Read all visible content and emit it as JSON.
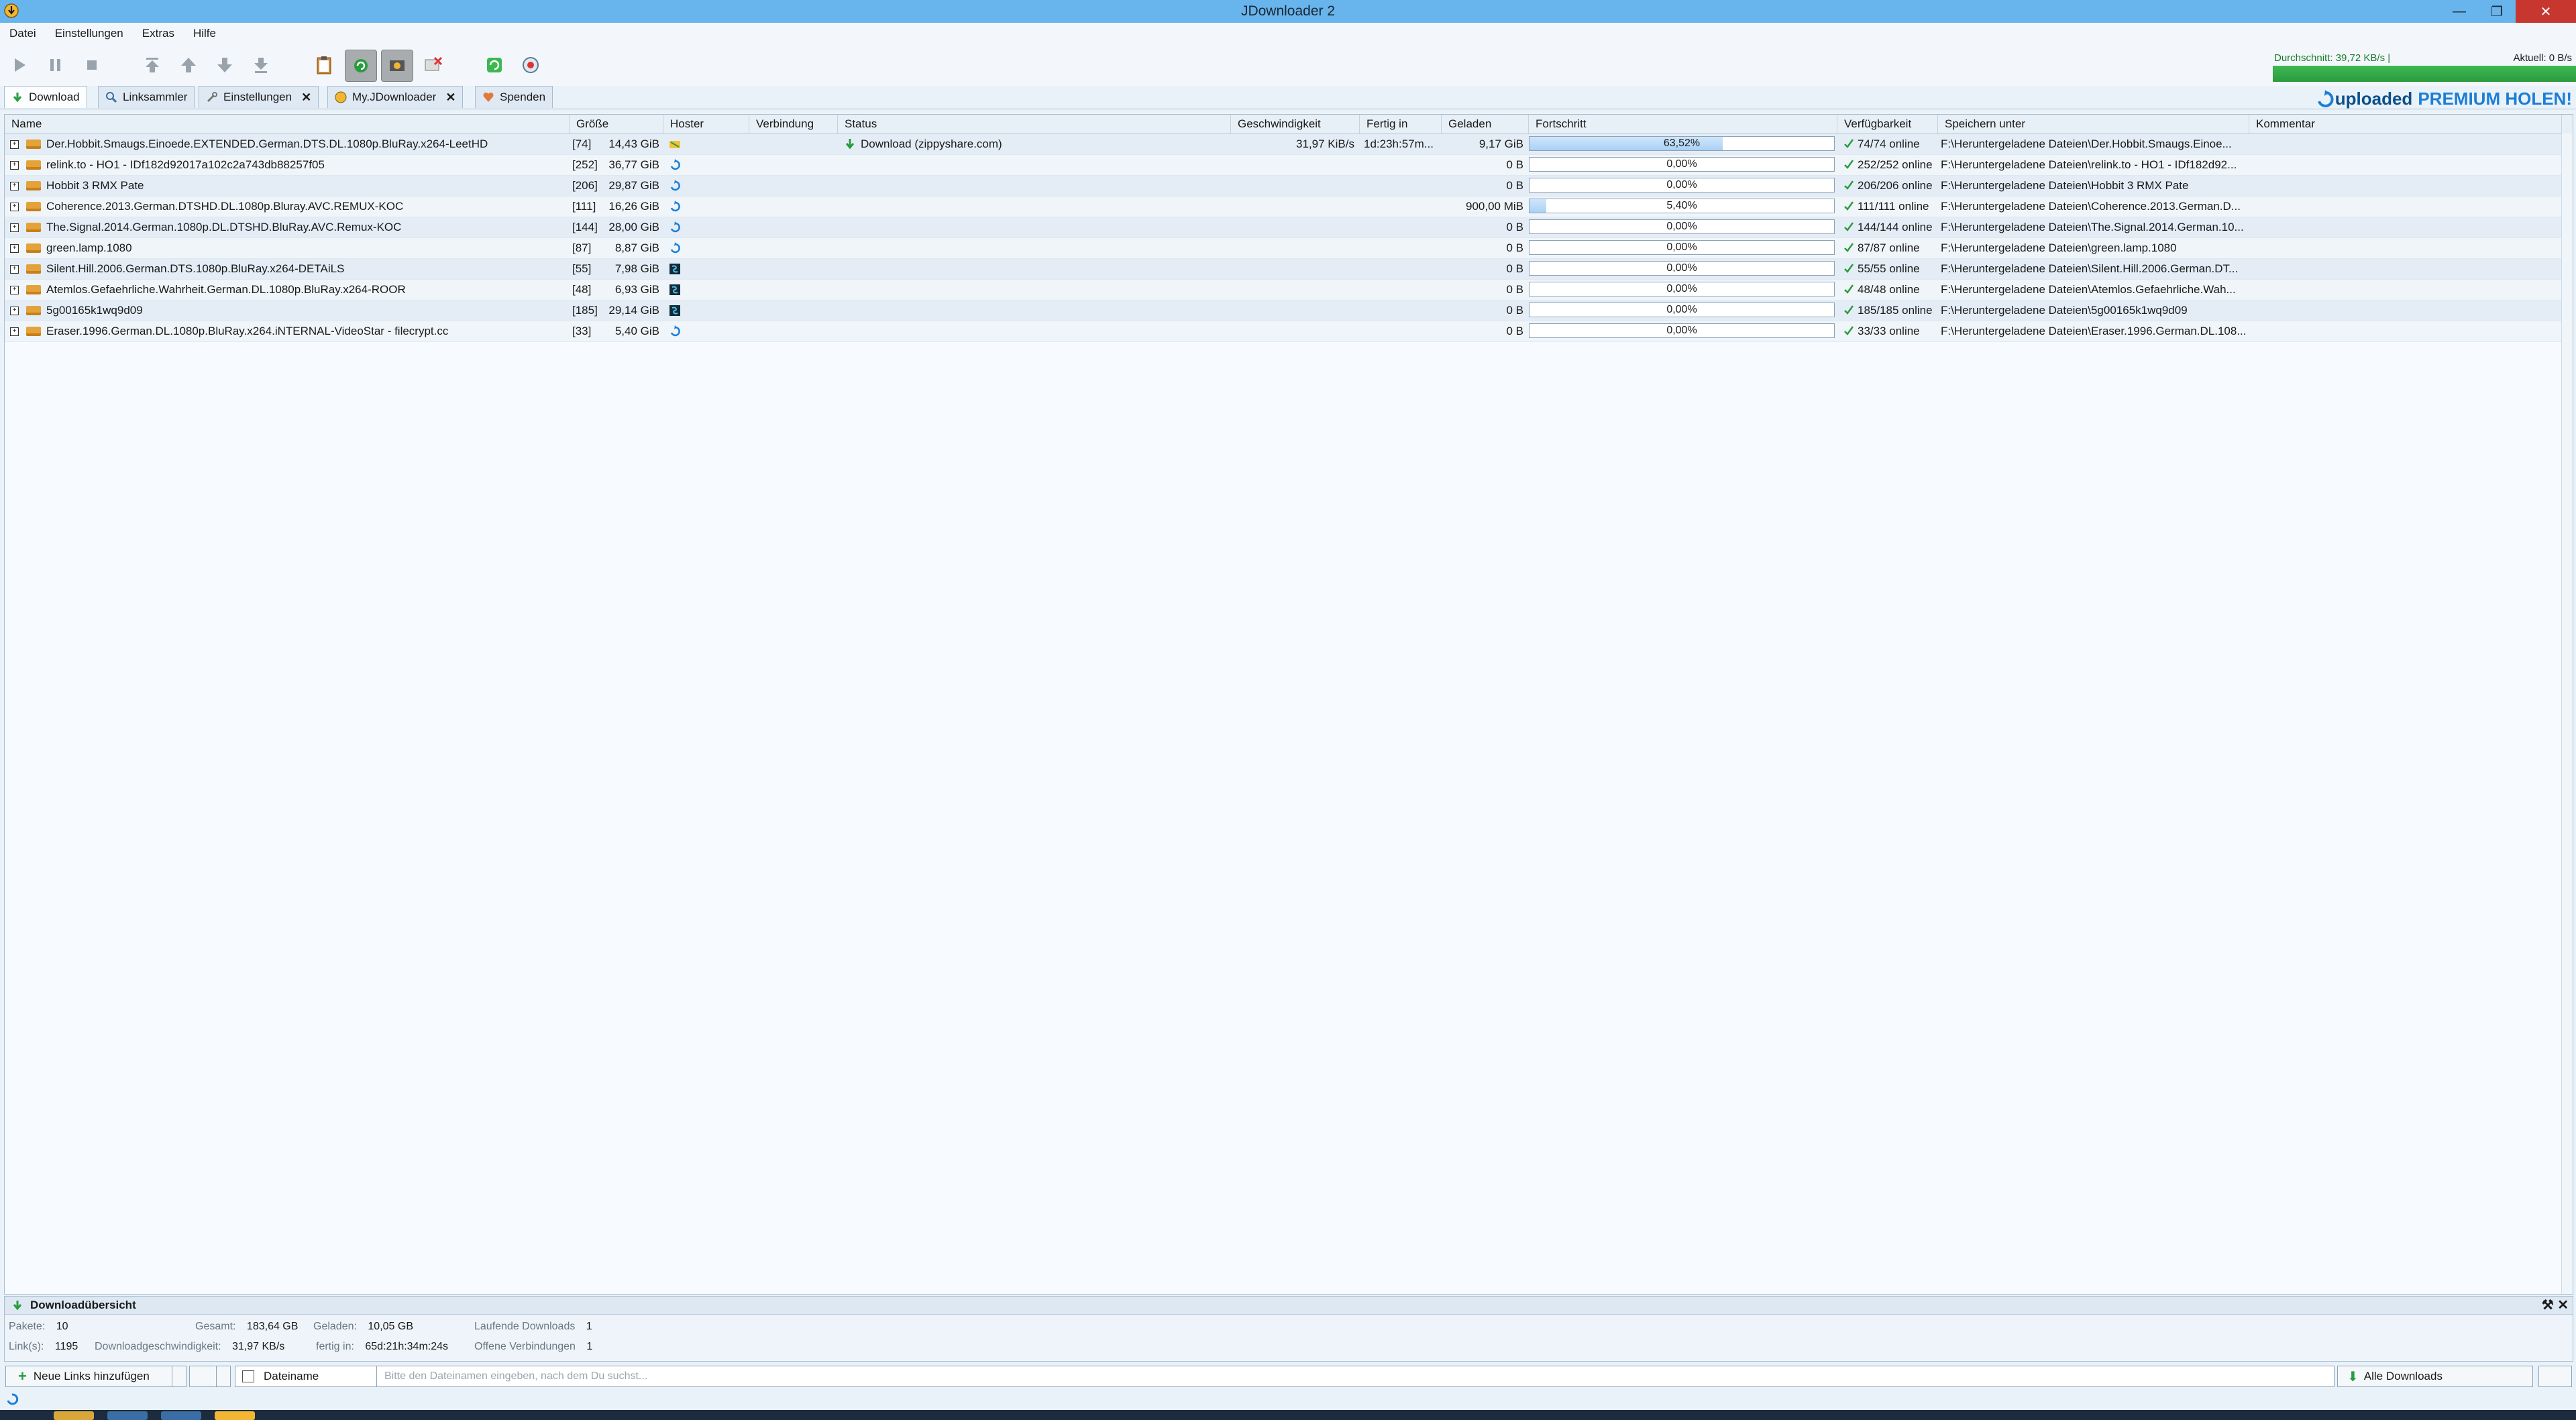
{
  "window": {
    "title": "JDownloader 2"
  },
  "menu": [
    "Datei",
    "Einstellungen",
    "Extras",
    "Hilfe"
  ],
  "toolbar": {
    "speed_avg": "Durchschnitt: 39,72 KB/s |",
    "speed_current": "Aktuell: 0 B/s"
  },
  "tabs": [
    {
      "label": "Download",
      "closable": false,
      "selected": true
    },
    {
      "label": "Linksammler",
      "closable": false,
      "selected": false
    },
    {
      "label": "Einstellungen",
      "closable": true,
      "selected": false
    },
    {
      "label": "My.JDownloader",
      "closable": true,
      "selected": false
    },
    {
      "label": "Spenden",
      "closable": false,
      "selected": false
    }
  ],
  "brand": {
    "name": "uploaded",
    "cta": "PREMIUM HOLEN!"
  },
  "columns": {
    "name": "Name",
    "size": "Größe",
    "hoster": "Hoster",
    "connection": "Verbindung",
    "status": "Status",
    "speed": "Geschwindigkeit",
    "eta": "Fertig in",
    "loaded": "Geladen",
    "progress": "Fortschritt",
    "availability": "Verfügbarkeit",
    "save_to": "Speichern unter",
    "comment": "Kommentar"
  },
  "rows": [
    {
      "name": "Der.Hobbit.Smaugs.Einoede.EXTENDED.German.DTS.DL.1080p.BluRay.x264-LeetHD",
      "count": "[74]",
      "size": "14,43 GiB",
      "hoster": "zippyshare",
      "status": "Download (zippyshare.com)",
      "speed": "31,97 KiB/s",
      "eta": "1d:23h:57m...",
      "loaded": "9,17 GiB",
      "progress": 63.52,
      "progress_label": "63,52%",
      "availability": "74/74 online",
      "save_to": "F:\\Heruntergeladene Dateien\\Der.Hobbit.Smaugs.Einoe..."
    },
    {
      "name": "relink.to - HO1 - IDf182d92017a102c2a743db88257f05",
      "count": "[252]",
      "size": "36,77 GiB",
      "hoster": "uploaded",
      "status": "",
      "speed": "",
      "eta": "",
      "loaded": "0 B",
      "progress": 0,
      "progress_label": "0,00%",
      "availability": "252/252 online",
      "save_to": "F:\\Heruntergeladene Dateien\\relink.to - HO1 - IDf182d92..."
    },
    {
      "name": "Hobbit 3 RMX Pate",
      "count": "[206]",
      "size": "29,87 GiB",
      "hoster": "uploaded",
      "status": "",
      "speed": "",
      "eta": "",
      "loaded": "0 B",
      "progress": 0,
      "progress_label": "0,00%",
      "availability": "206/206 online",
      "save_to": "F:\\Heruntergeladene Dateien\\Hobbit 3 RMX Pate"
    },
    {
      "name": "Coherence.2013.German.DTSHD.DL.1080p.Bluray.AVC.REMUX-KOC",
      "count": "[111]",
      "size": "16,26 GiB",
      "hoster": "uploaded",
      "status": "",
      "speed": "",
      "eta": "",
      "loaded": "900,00 MiB",
      "progress": 5.4,
      "progress_label": "5,40%",
      "availability": "111/111 online",
      "save_to": "F:\\Heruntergeladene Dateien\\Coherence.2013.German.D..."
    },
    {
      "name": "The.Signal.2014.German.1080p.DL.DTSHD.BluRay.AVC.Remux-KOC",
      "count": "[144]",
      "size": "28,00 GiB",
      "hoster": "uploaded",
      "status": "",
      "speed": "",
      "eta": "",
      "loaded": "0 B",
      "progress": 0,
      "progress_label": "0,00%",
      "availability": "144/144 online",
      "save_to": "F:\\Heruntergeladene Dateien\\The.Signal.2014.German.10..."
    },
    {
      "name": "green.lamp.1080",
      "count": "[87]",
      "size": "8,87 GiB",
      "hoster": "uploaded",
      "status": "",
      "speed": "",
      "eta": "",
      "loaded": "0 B",
      "progress": 0,
      "progress_label": "0,00%",
      "availability": "87/87 online",
      "save_to": "F:\\Heruntergeladene Dateien\\green.lamp.1080"
    },
    {
      "name": "Silent.Hill.2006.German.DTS.1080p.BluRay.x264-DETAiLS",
      "count": "[55]",
      "size": "7,98 GiB",
      "hoster": "share-online",
      "status": "",
      "speed": "",
      "eta": "",
      "loaded": "0 B",
      "progress": 0,
      "progress_label": "0,00%",
      "availability": "55/55 online",
      "save_to": "F:\\Heruntergeladene Dateien\\Silent.Hill.2006.German.DT..."
    },
    {
      "name": "Atemlos.Gefaehrliche.Wahrheit.German.DL.1080p.BluRay.x264-ROOR",
      "count": "[48]",
      "size": "6,93 GiB",
      "hoster": "share-online",
      "status": "",
      "speed": "",
      "eta": "",
      "loaded": "0 B",
      "progress": 0,
      "progress_label": "0,00%",
      "availability": "48/48 online",
      "save_to": "F:\\Heruntergeladene Dateien\\Atemlos.Gefaehrliche.Wah..."
    },
    {
      "name": "5g00165k1wq9d09",
      "count": "[185]",
      "size": "29,14 GiB",
      "hoster": "share-online",
      "status": "",
      "speed": "",
      "eta": "",
      "loaded": "0 B",
      "progress": 0,
      "progress_label": "0,00%",
      "availability": "185/185 online",
      "save_to": "F:\\Heruntergeladene Dateien\\5g00165k1wq9d09"
    },
    {
      "name": "Eraser.1996.German.DL.1080p.BluRay.x264.iNTERNAL-VideoStar - filecrypt.cc",
      "count": "[33]",
      "size": "5,40 GiB",
      "hoster": "uploaded",
      "status": "",
      "speed": "",
      "eta": "",
      "loaded": "0 B",
      "progress": 0,
      "progress_label": "0,00%",
      "availability": "33/33 online",
      "save_to": "F:\\Heruntergeladene Dateien\\Eraser.1996.German.DL.108..."
    }
  ],
  "overview": {
    "title": "Downloadübersicht",
    "packages_label": "Pakete:",
    "packages": "10",
    "links_label": "Link(s):",
    "links": "1195",
    "total_label": "Gesamt:",
    "total": "183,64 GB",
    "speed_label": "Downloadgeschwindigkeit:",
    "speed": "31,97 KB/s",
    "loaded_label": "Geladen:",
    "loaded": "10,05 GB",
    "eta_label": "fertig in:",
    "eta": "65d:21h:34m:24s",
    "running_label": "Laufende Downloads",
    "running": "1",
    "open_conn_label": "Offene Verbindungen",
    "open_conn": "1"
  },
  "bottom": {
    "add_links": "Neue Links hinzufügen",
    "filter_field": "Dateiname",
    "search_placeholder": "Bitte den Dateinamen eingeben, nach dem Du suchst...",
    "view": "Alle Downloads"
  },
  "colors": {
    "titlebar": "#68b4ec",
    "close": "#c7372f",
    "speed_bar": "#3db851",
    "accent": "#1c7ed6"
  }
}
